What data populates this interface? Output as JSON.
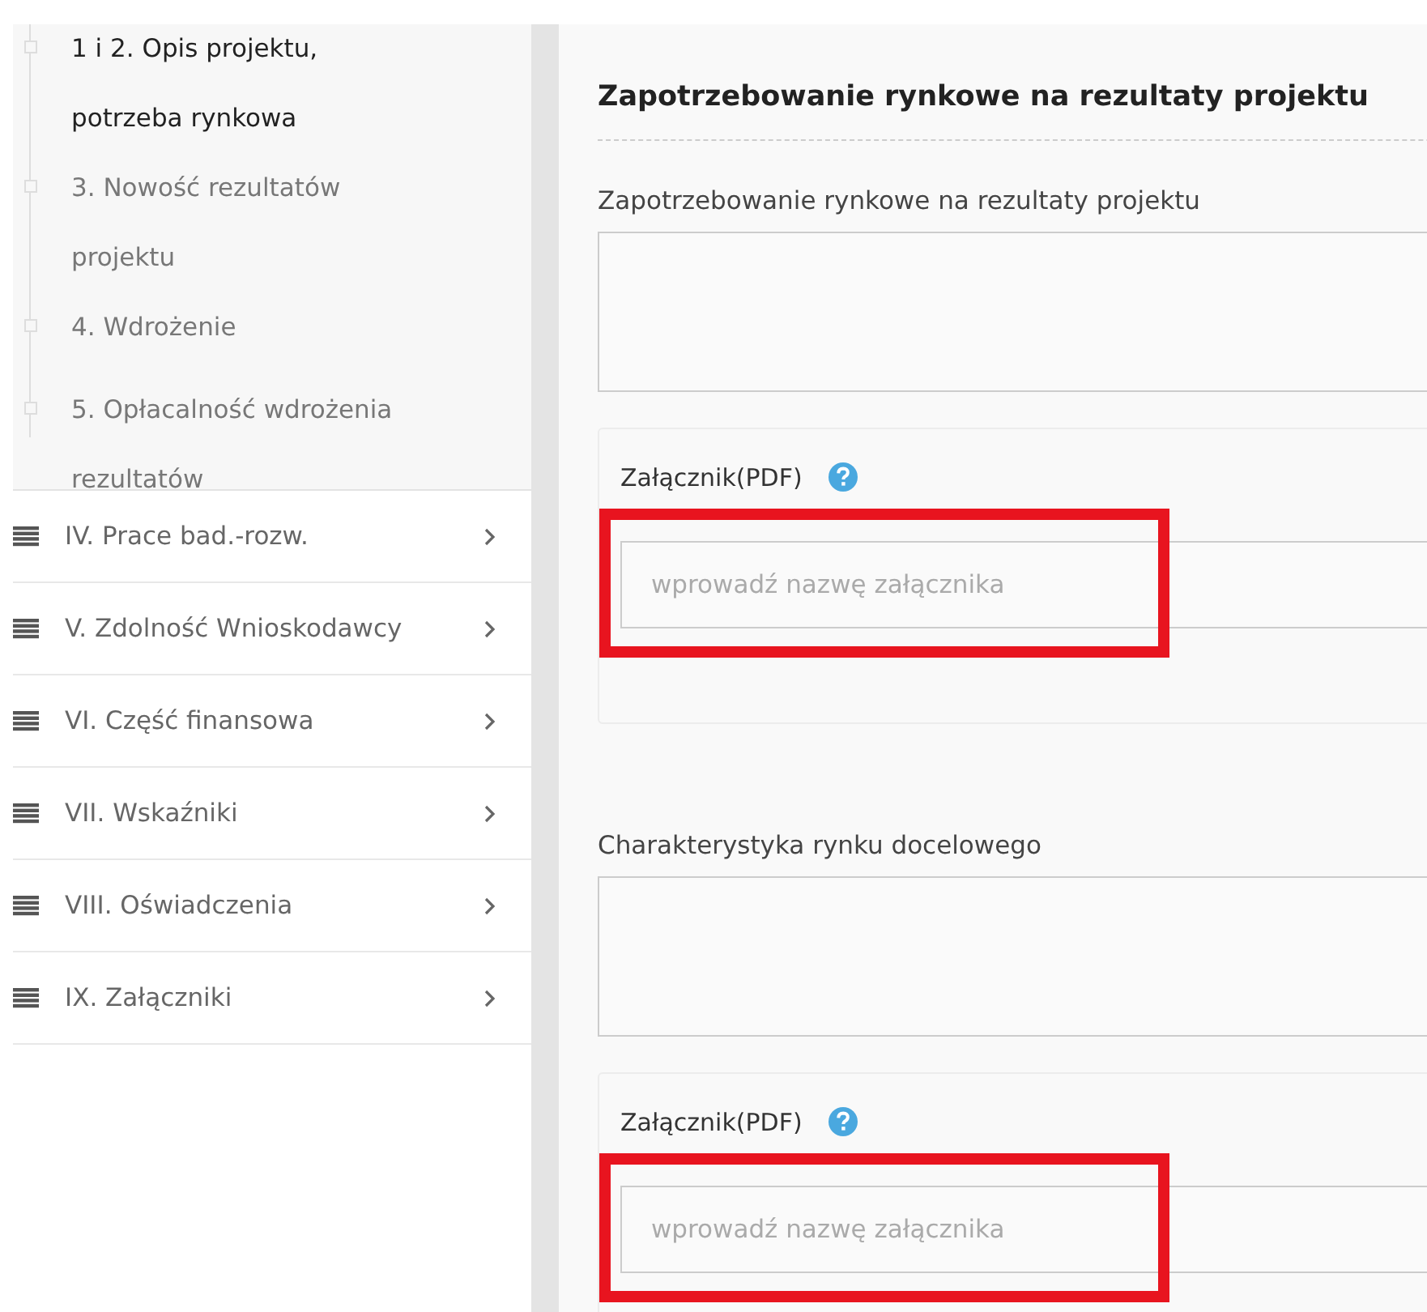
{
  "sidebar": {
    "subitems": [
      {
        "label": "1 i 2. Opis projektu, potrzeba rynkowa",
        "selected": true
      },
      {
        "label": "3. Nowość rezultatów projektu",
        "selected": false
      },
      {
        "label": "4. Wdrożenie",
        "selected": false
      },
      {
        "label": "5. Opłacalność wdrożenia rezultatów",
        "selected": false
      }
    ],
    "sections": [
      {
        "label": "IV. Prace bad.-rozw."
      },
      {
        "label": "V. Zdolność Wnioskodawcy"
      },
      {
        "label": "VI. Część finansowa"
      },
      {
        "label": "VII. Wskaźniki"
      },
      {
        "label": "VIII. Oświadczenia"
      },
      {
        "label": "IX. Załączniki"
      }
    ]
  },
  "main": {
    "heading": "Zapotrzebowanie rynkowe na rezultaty projektu",
    "fields": [
      {
        "label": "Zapotrzebowanie rynkowe na rezultaty projektu",
        "attachment": {
          "label": "Załącznik(PDF)",
          "placeholder": "wprowadź nazwę załącznika",
          "highlighted": true
        }
      },
      {
        "label": "Charakterystyka rynku docelowego",
        "attachment": {
          "label": "Załącznik(PDF)",
          "placeholder": "wprowadź nazwę załącznika",
          "highlighted": true
        }
      }
    ]
  }
}
